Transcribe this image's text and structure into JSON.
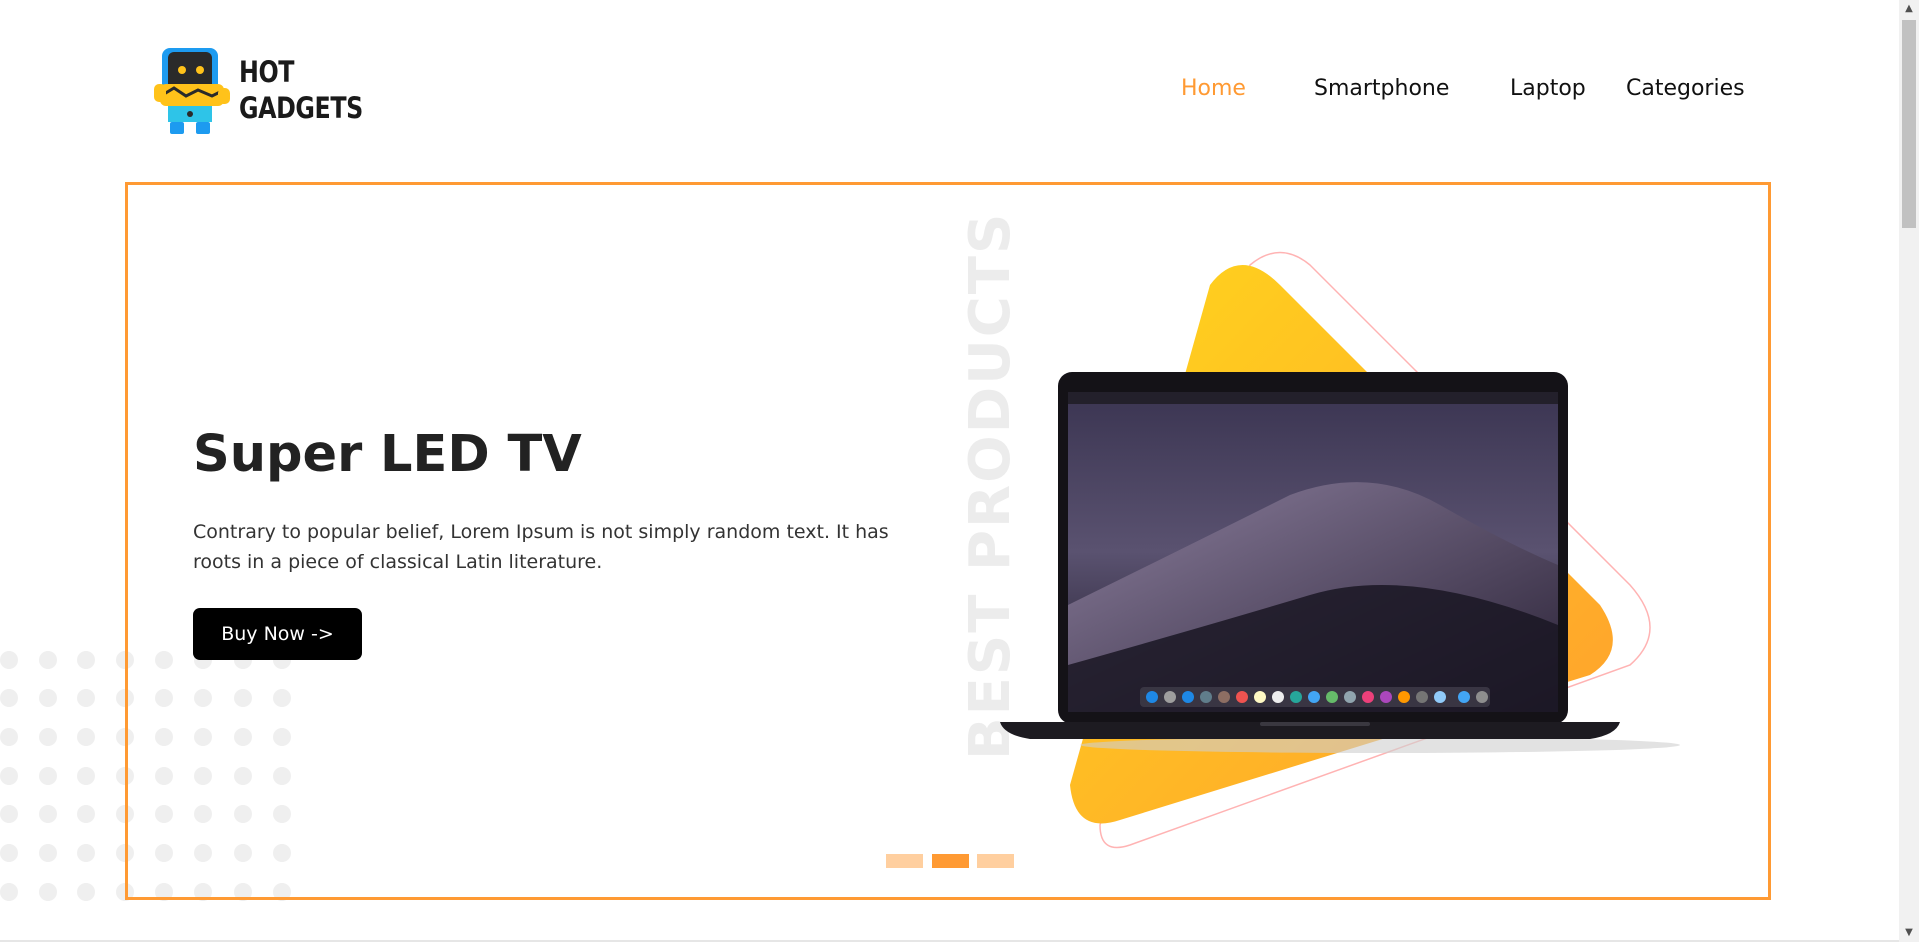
{
  "brand": {
    "line1": "HOT",
    "line2": "GADGETS"
  },
  "nav": {
    "items": [
      {
        "label": "Home",
        "active": true
      },
      {
        "label": "Smartphone"
      },
      {
        "label": "Laptop"
      },
      {
        "label": "Categories"
      }
    ]
  },
  "hero": {
    "title": "Super LED TV",
    "description": "Contrary to popular belief, Lorem Ipsum is not simply random text. It has roots in a piece of classical Latin literature.",
    "button_label": "Buy Now ->",
    "vertical_text": "BEST PRODUCTS"
  },
  "carousel": {
    "slides": 3,
    "active_index": 1
  },
  "colors": {
    "accent": "#ff9a33",
    "pager_inactive": "#ffcf9f",
    "button_bg": "#000000",
    "triangle_top": "#ffd51c",
    "triangle_bottom": "#ff9f2e",
    "outline_pink": "#ffb3b3"
  },
  "icons": {
    "logo": "robot-mascot-icon",
    "scroll_up": "arrow-up-icon",
    "scroll_down": "arrow-down-icon"
  }
}
